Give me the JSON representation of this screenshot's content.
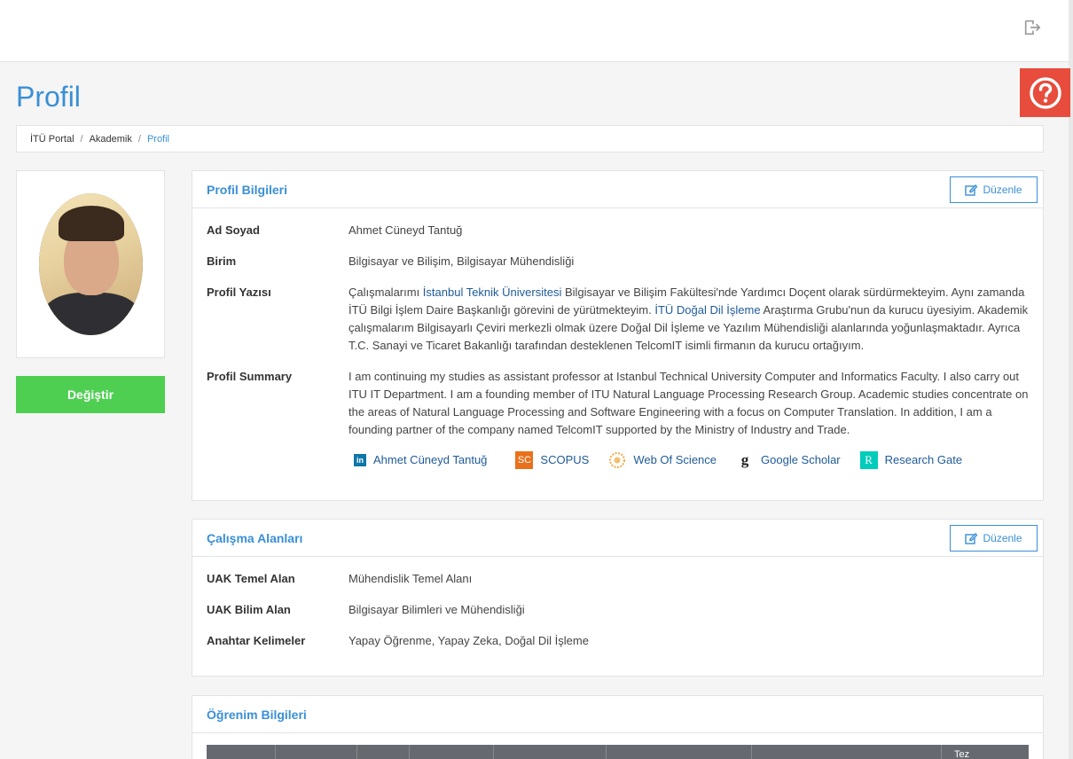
{
  "page": {
    "title": "Profil"
  },
  "breadcrumb": {
    "items": [
      "İTÜ Portal",
      "Akademik",
      "Profil"
    ],
    "sep": "/"
  },
  "sidebar": {
    "change_button": "Değiştir"
  },
  "profile_card": {
    "title": "Profil Bilgileri",
    "edit_label": "Düzenle",
    "name_label": "Ad Soyad",
    "name": "Ahmet Cüneyd Tantuğ",
    "unit_label": "Birim",
    "unit": "Bilgisayar ve Bilişim, Bilgisayar Mühendisliği",
    "bio_label": "Profil Yazısı",
    "bio_p1": "Çalışmalarımı ",
    "bio_link1": "İstanbul Teknik Üniversitesi",
    "bio_p2": " Bilgisayar ve Bilişim Fakültesi'nde Yardımcı Doçent olarak sürdürmekteyim. Aynı zamanda İTÜ Bilgi İşlem Daire Başkanlığı görevini de yürütmekteyim. ",
    "bio_link2": "İTÜ Doğal Dil İşleme",
    "bio_p3": " Araştırma Grubu'nun da kurucu üyesiyim. Akademik çalışmalarım Bilgisayarlı Çeviri merkezli olmak üzere Doğal Dil İşleme ve Yazılım Mühendisliği alanlarında yoğunlaşmaktadır. Ayrıca T.C. Sanayi ve Ticaret Bakanlığı tarafından desteklenen TelcomIT isimli firmanın da kurucu ortağıyım.",
    "summary_label": "Profil Summary",
    "summary": "I am continuing my studies as assistant professor at Istanbul Technical University Computer and Informatics Faculty. I also carry out ITU IT Department. I am a founding member of ITU Natural Language Processing Research Group. Academic studies concentrate on the areas of Natural Language Processing and Software Engineering with a focus on Computer Translation. In addition, I am a founding partner of the company named TelcomIT supported by the Ministry of Industry and Trade.",
    "links": [
      {
        "label": "Ahmet Cüneyd Tantuğ",
        "icon": "linkedin-icon",
        "badge": "in",
        "color": "#0e76a8"
      },
      {
        "label": "SCOPUS",
        "icon": "scopus-icon",
        "badge": "SC",
        "color": "#e9711c"
      },
      {
        "label": "Web Of Science",
        "icon": "web-of-science-icon",
        "badge": "",
        "color": "#f3a847"
      },
      {
        "label": "Google Scholar",
        "icon": "google-scholar-icon",
        "badge": "g",
        "color": "#222222"
      },
      {
        "label": "Research Gate",
        "icon": "researchgate-icon",
        "badge": "R",
        "color": "#00ccbb"
      }
    ]
  },
  "work_card": {
    "title": "Çalışma Alanları",
    "edit_label": "Düzenle",
    "rows": [
      {
        "label": "UAK Temel Alan",
        "value": "Mühendislik Temel Alanı"
      },
      {
        "label": "UAK Bilim Alan",
        "value": "Bilgisayar Bilimleri ve Mühendisliği"
      },
      {
        "label": "Anahtar Kelimeler",
        "value": "Yapay Öğrenme, Yapay Zeka, Doğal Dil İşleme"
      }
    ]
  },
  "education_card": {
    "title": "Öğrenim Bilgileri",
    "header_partial": "Tez"
  },
  "colors": {
    "accent": "#3a8fd6",
    "green": "#4fcf52",
    "help_red": "#e74c3c"
  }
}
